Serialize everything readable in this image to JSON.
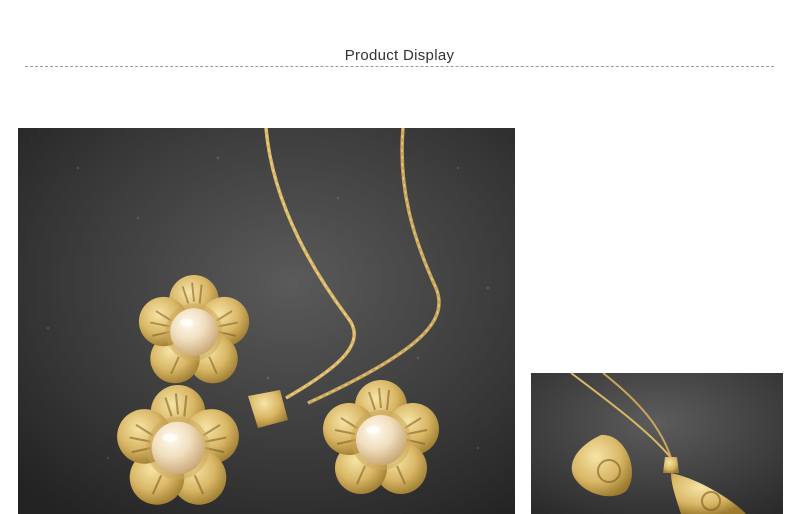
{
  "section": {
    "title": "Product Display"
  },
  "colors": {
    "background_dark": "#3a3a3a",
    "gold": "#d9b766",
    "gold_shadow": "#9c7a2e",
    "pearl": "#f1dfbf",
    "divider": "#9a9a9a",
    "title_text": "#333333"
  },
  "images": [
    {
      "name": "flower-pearl-jewelry-set",
      "icon": "product-photo"
    },
    {
      "name": "teardrop-filigree-jewelry-set",
      "icon": "product-photo"
    }
  ]
}
